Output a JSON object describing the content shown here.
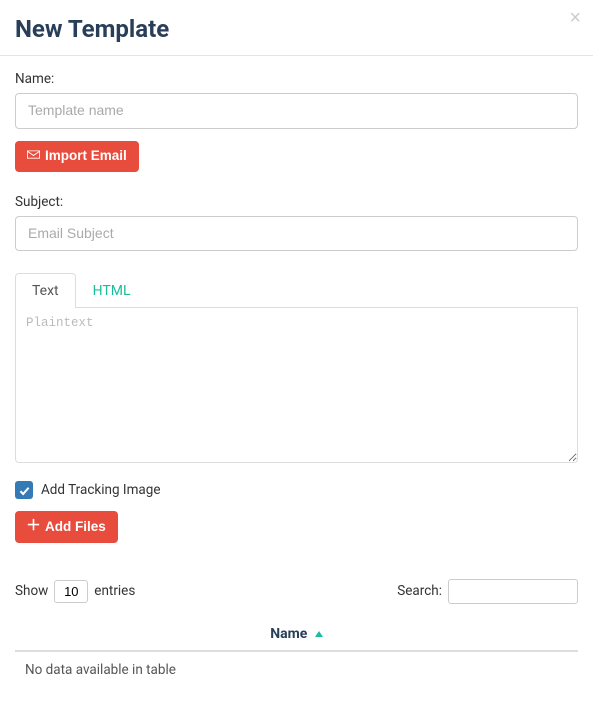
{
  "header": {
    "title": "New Template"
  },
  "form": {
    "name_label": "Name:",
    "name_placeholder": "Template name",
    "name_value": "",
    "import_label": "Import Email",
    "subject_label": "Subject:",
    "subject_placeholder": "Email Subject",
    "subject_value": "",
    "tabs": {
      "text": "Text",
      "html": "HTML"
    },
    "text_placeholder": "Plaintext",
    "text_value": "",
    "tracking_label": "Add Tracking Image",
    "tracking_checked": true,
    "add_files_label": "Add Files"
  },
  "table": {
    "show_label": "Show",
    "entries_value": "10",
    "entries_label": "entries",
    "search_label": "Search:",
    "search_value": "",
    "columns": {
      "name": "Name"
    },
    "empty_text": "No data available in table"
  },
  "colors": {
    "accent": "#e74c3c",
    "link": "#1abc9c",
    "heading": "#283e59",
    "checkbox": "#337ab7"
  }
}
